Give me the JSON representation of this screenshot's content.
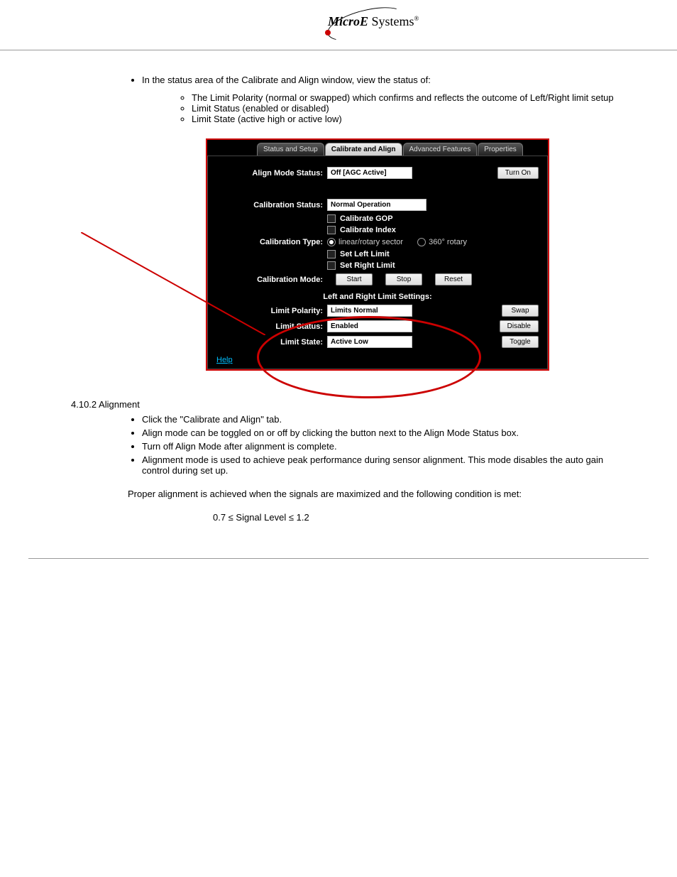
{
  "logo": {
    "micro": "Micro",
    "e": "E",
    "systems": " Systems",
    "reg": "®"
  },
  "doc": {
    "top_bullet": "In the status area of the Calibrate and Align window, view the status of:",
    "subs": [
      "The Limit Polarity (normal or swapped) which confirms and reflects the outcome of Left/Right limit setup",
      "Limit Status (enabled or disabled)",
      "Limit State (active high or active low)"
    ],
    "bottom_title": "4.10.2 Alignment",
    "bottom_bullets": [
      "Click the \"Calibrate and Align\" tab.",
      "Align mode can be toggled on or off by clicking the button next to the Align Mode Status box.",
      "Turn off Align Mode after alignment is complete.",
      "Alignment mode is used to achieve peak performance during sensor alignment. This mode disables the auto gain control during set up."
    ],
    "bottom_text1": "Proper alignment is achieved when the signals are maximized and the following condition is met:",
    "bottom_text2": "0.7 ≤ Signal Level ≤ 1.2"
  },
  "ui": {
    "tabs": [
      "Status and Setup",
      "Calibrate and Align",
      "Advanced Features",
      "Properties"
    ],
    "align_mode_label": "Align Mode Status:",
    "align_mode_value": "Off [AGC Active]",
    "turn_on": "Turn On",
    "cal_status_label": "Calibration Status:",
    "cal_status_value": "Normal Operation",
    "chk_gop": "Calibrate GOP",
    "chk_index": "Calibrate Index",
    "cal_type_label": "Calibration Type:",
    "radio_linear": "linear/rotary sector",
    "radio_rotary": "360° rotary",
    "chk_left": "Set Left Limit",
    "chk_right": "Set Right Limit",
    "cal_mode_label": "Calibration Mode:",
    "btn_start": "Start",
    "btn_stop": "Stop",
    "btn_reset": "Reset",
    "lr_title": "Left and Right Limit Settings:",
    "limit_polarity_label": "Limit Polarity:",
    "limit_polarity_value": "Limits Normal",
    "btn_swap": "Swap",
    "limit_status_label": "Limit Status:",
    "limit_status_value": "Enabled",
    "btn_disable": "Disable",
    "limit_state_label": "Limit State:",
    "limit_state_value": "Active Low",
    "btn_toggle": "Toggle",
    "help": "Help"
  }
}
